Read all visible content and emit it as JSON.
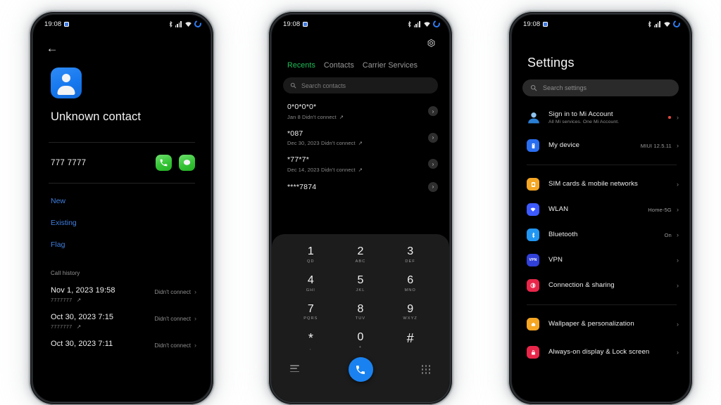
{
  "status_bar": {
    "time": "19:08",
    "icons": [
      "screen-record-indicator",
      "bluetooth-icon",
      "signal-bars-icon",
      "wifi-icon",
      "battery-charging-icon"
    ]
  },
  "phone1": {
    "name": "contact-details-screen",
    "back_label": "←",
    "contact_name": "Unknown contact",
    "phone_number": "777 7777",
    "actions": [
      {
        "name": "call-action",
        "icon": "phone-icon"
      },
      {
        "name": "message-action",
        "icon": "message-icon"
      }
    ],
    "links": [
      "New",
      "Existing",
      "Flag"
    ],
    "call_history_header": "Call history",
    "call_history": [
      {
        "date": "Nov 1, 2023 19:58",
        "number": "7777777",
        "status": "Didn't connect"
      },
      {
        "date": "Oct 30, 2023 7:15",
        "number": "7777777",
        "status": "Didn't connect"
      },
      {
        "date": "Oct 30, 2023 7:11",
        "number": "",
        "status": "Didn't connect"
      }
    ]
  },
  "phone2": {
    "name": "dialer-screen",
    "settings_icon": "gear-icon",
    "tabs": [
      {
        "label": "Recents",
        "active": true
      },
      {
        "label": "Contacts",
        "active": false
      },
      {
        "label": "Carrier Services",
        "active": false
      }
    ],
    "search_placeholder": "Search contacts",
    "active_tab_color": "#1fbd59",
    "recents": [
      {
        "number": "0*0*0*0*",
        "detail": "Jan 8 Didn't connect"
      },
      {
        "number": "*087",
        "detail": "Dec 30, 2023 Didn't connect"
      },
      {
        "number": "*77*7*",
        "detail": "Dec 14, 2023 Didn't connect"
      },
      {
        "number": "****7874",
        "detail": ""
      }
    ],
    "dialpad": [
      {
        "digit": "1",
        "sub": "QD"
      },
      {
        "digit": "2",
        "sub": "ABC"
      },
      {
        "digit": "3",
        "sub": "DEF"
      },
      {
        "digit": "4",
        "sub": "GHI"
      },
      {
        "digit": "5",
        "sub": "JKL"
      },
      {
        "digit": "6",
        "sub": "MNO"
      },
      {
        "digit": "7",
        "sub": "PQRS"
      },
      {
        "digit": "8",
        "sub": "TUV"
      },
      {
        "digit": "9",
        "sub": "WXYZ"
      },
      {
        "digit": "*",
        "sub": ","
      },
      {
        "digit": "0",
        "sub": "+"
      },
      {
        "digit": "#",
        "sub": ""
      }
    ],
    "call_button_color": "#1a82f0",
    "pad_left_icon": "menu-lines-icon",
    "pad_right_icon": "keypad-dots-icon"
  },
  "phone3": {
    "name": "settings-screen",
    "title": "Settings",
    "search_placeholder": "Search settings",
    "groups": [
      {
        "items": [
          {
            "label": "Sign in to Mi Account",
            "sub": "All Mi services. One Mi Account.",
            "value": "",
            "icon": "mi-account-avatar-icon",
            "badge": true
          },
          {
            "label": "My device",
            "sub": "",
            "value": "MIUI 12.5.11",
            "icon": "device-icon",
            "badge": false
          }
        ]
      },
      {
        "items": [
          {
            "label": "SIM cards & mobile networks",
            "sub": "",
            "value": "",
            "icon": "sim-card-icon",
            "badge": false
          },
          {
            "label": "WLAN",
            "sub": "",
            "value": "Home-5G",
            "icon": "wifi-icon",
            "badge": false
          },
          {
            "label": "Bluetooth",
            "sub": "",
            "value": "On",
            "icon": "bluetooth-icon",
            "badge": false
          },
          {
            "label": "VPN",
            "sub": "",
            "value": "",
            "icon": "vpn-icon",
            "badge": false
          },
          {
            "label": "Connection & sharing",
            "sub": "",
            "value": "",
            "icon": "connection-sharing-icon",
            "badge": false
          }
        ]
      },
      {
        "items": [
          {
            "label": "Wallpaper & personalization",
            "sub": "",
            "value": "",
            "icon": "wallpaper-icon",
            "badge": false
          },
          {
            "label": "Always-on display & Lock screen",
            "sub": "",
            "value": "",
            "icon": "lock-screen-icon",
            "badge": false
          }
        ]
      }
    ],
    "icon_colors": {
      "device": "#2a6ef0",
      "sim": "#f5a623",
      "wlan": "#3d5afe",
      "bluetooth": "#2196f3",
      "vpn": "#3040d8",
      "connection": "#e8264a",
      "wallpaper": "#f5a623",
      "lock": "#e8264a",
      "badge": "#e04a3c"
    }
  }
}
